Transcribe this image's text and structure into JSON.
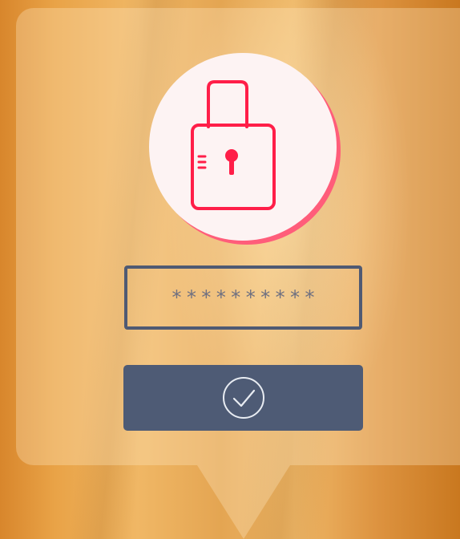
{
  "login": {
    "lock_icon": "padlock-icon",
    "password_mask": "**********",
    "submit_icon": "checkmark-circle-icon"
  },
  "colors": {
    "accent": "#ff1e48",
    "accent_shadow": "#ff5d7a",
    "button": "#4e5b75",
    "field_border": "#4f5a73",
    "background_orange": "#e9a347"
  }
}
